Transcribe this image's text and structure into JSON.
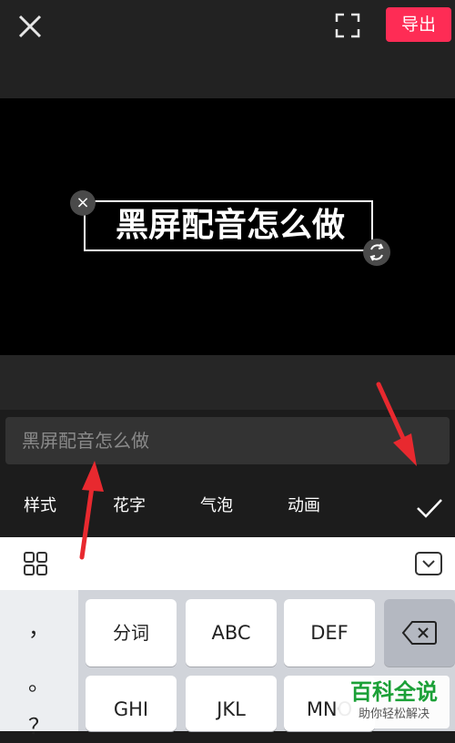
{
  "header": {
    "close_icon": "close-icon",
    "fullscreen_icon": "fullscreen-icon",
    "export_label": "导出"
  },
  "preview": {
    "caption": "黑屏配音怎么做",
    "delete_icon": "close-icon",
    "rotate_icon": "rotate-icon"
  },
  "editor": {
    "input_value": "黑屏配音怎么做"
  },
  "tabs": [
    {
      "label": "样式"
    },
    {
      "label": "花字"
    },
    {
      "label": "气泡"
    },
    {
      "label": "动画"
    }
  ],
  "ime": {
    "grid_icon": "grid-icon",
    "hide_icon": "keyboard-hide-icon"
  },
  "keyboard": {
    "punctuation": [
      "，",
      "。",
      "？"
    ],
    "row1": [
      "分词",
      "ABC",
      "DEF"
    ],
    "row2": [
      "GHI",
      "JKL",
      "MNO"
    ],
    "backspace_icon": "backspace-icon"
  },
  "watermark": {
    "title": "百科全说",
    "subtitle": "助你轻松解决"
  },
  "colors": {
    "accent": "#fe2c55",
    "annotation_arrow": "#e8292f",
    "watermark_green": "#1ba037"
  }
}
